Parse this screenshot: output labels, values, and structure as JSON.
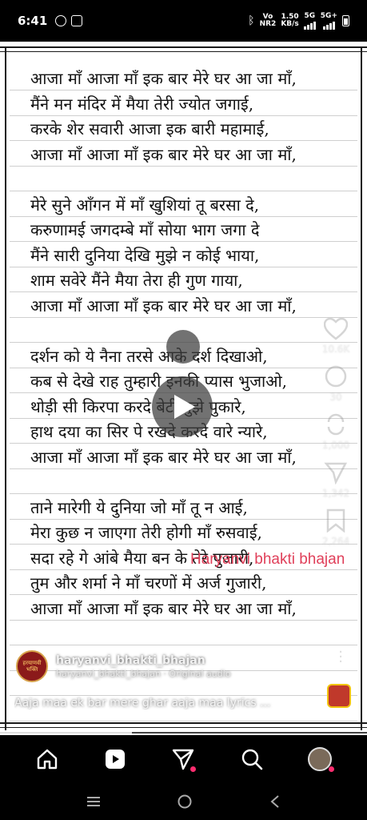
{
  "status_bar": {
    "time": "6:41",
    "network_top": "Vo",
    "network_bottom": "NR2",
    "speed_top": "1.50",
    "speed_bottom": "KB/s",
    "gen_top": "5G",
    "gen2": "5G+"
  },
  "lyrics": [
    "आजा माँ आजा माँ इक बार मेरे घर आ जा माँ,",
    "मैंने मन मंदिर में मैया तेरी ज्योत जगाई,",
    "करके शेर सवारी आजा इक बारी महामाई,",
    "आजा माँ आजा माँ इक बार मेरे घर आ जा माँ,",
    "",
    "मेरे सुने आँगन में माँ खुशियां तू बरसा दे,",
    "करुणामई जगदम्बे माँ सोया भाग जगा दे",
    "मैंने सारी दुनिया देखि मुझे न कोई भाया,",
    "शाम सवेरे मैंने मैया तेरा ही गुण गाया,",
    "आजा माँ आजा माँ इक बार मेरे घर आ जा माँ,",
    "",
    "दर्शन को ये नैना तरसे आके दर्श दिखाओ,",
    "कब से देखे राह तुम्हारी इनकी प्यास भुजाओ,",
    "थोड़ी सी किरपा करदे बेटी तुझे पुकारे,",
    "हाथ दया का सिर पे रखदे करदे वारे न्यारे,",
    "आजा माँ आजा माँ इक बार मेरे घर आ जा माँ,",
    "",
    "ताने मारेगी ये दुनिया जो माँ तू न आई,",
    "मेरा कुछ न जाएगा तेरी होगी माँ रुसवाई,",
    "सदा रहे गे आंबे मैया बन के तेरे पुजारी,",
    "तुम और शर्मा ने माँ चरणों में अर्ज गुजारी,",
    "आजा माँ आजा माँ इक बार मेरे घर आ जा माँ,"
  ],
  "watermark": "Haryanvi bhakti bhajan",
  "side_actions": {
    "like_count": "10.6K",
    "comment_count": "30",
    "repost_count": "1,000",
    "share_count": "1,342",
    "save_count": "2,264"
  },
  "author": {
    "avatar_text": "हरयाणवी भक्ति",
    "name": "haryanvi_bhakti_bhajan",
    "audio": "haryanvi_bhakti_bhajan · Original audio",
    "follow_label": "Follow"
  },
  "caption": "Aaja maa ek bar mere ghar aaja maa lyrics ...",
  "playback": {
    "progress": 0.36
  },
  "bottom_nav": [
    "home-icon",
    "reels-icon",
    "send-icon",
    "search-icon",
    "profile-avatar"
  ],
  "colors": {
    "watermark": "#e0405a",
    "badge": "#ff2d6f",
    "paper": "#ffffff"
  }
}
